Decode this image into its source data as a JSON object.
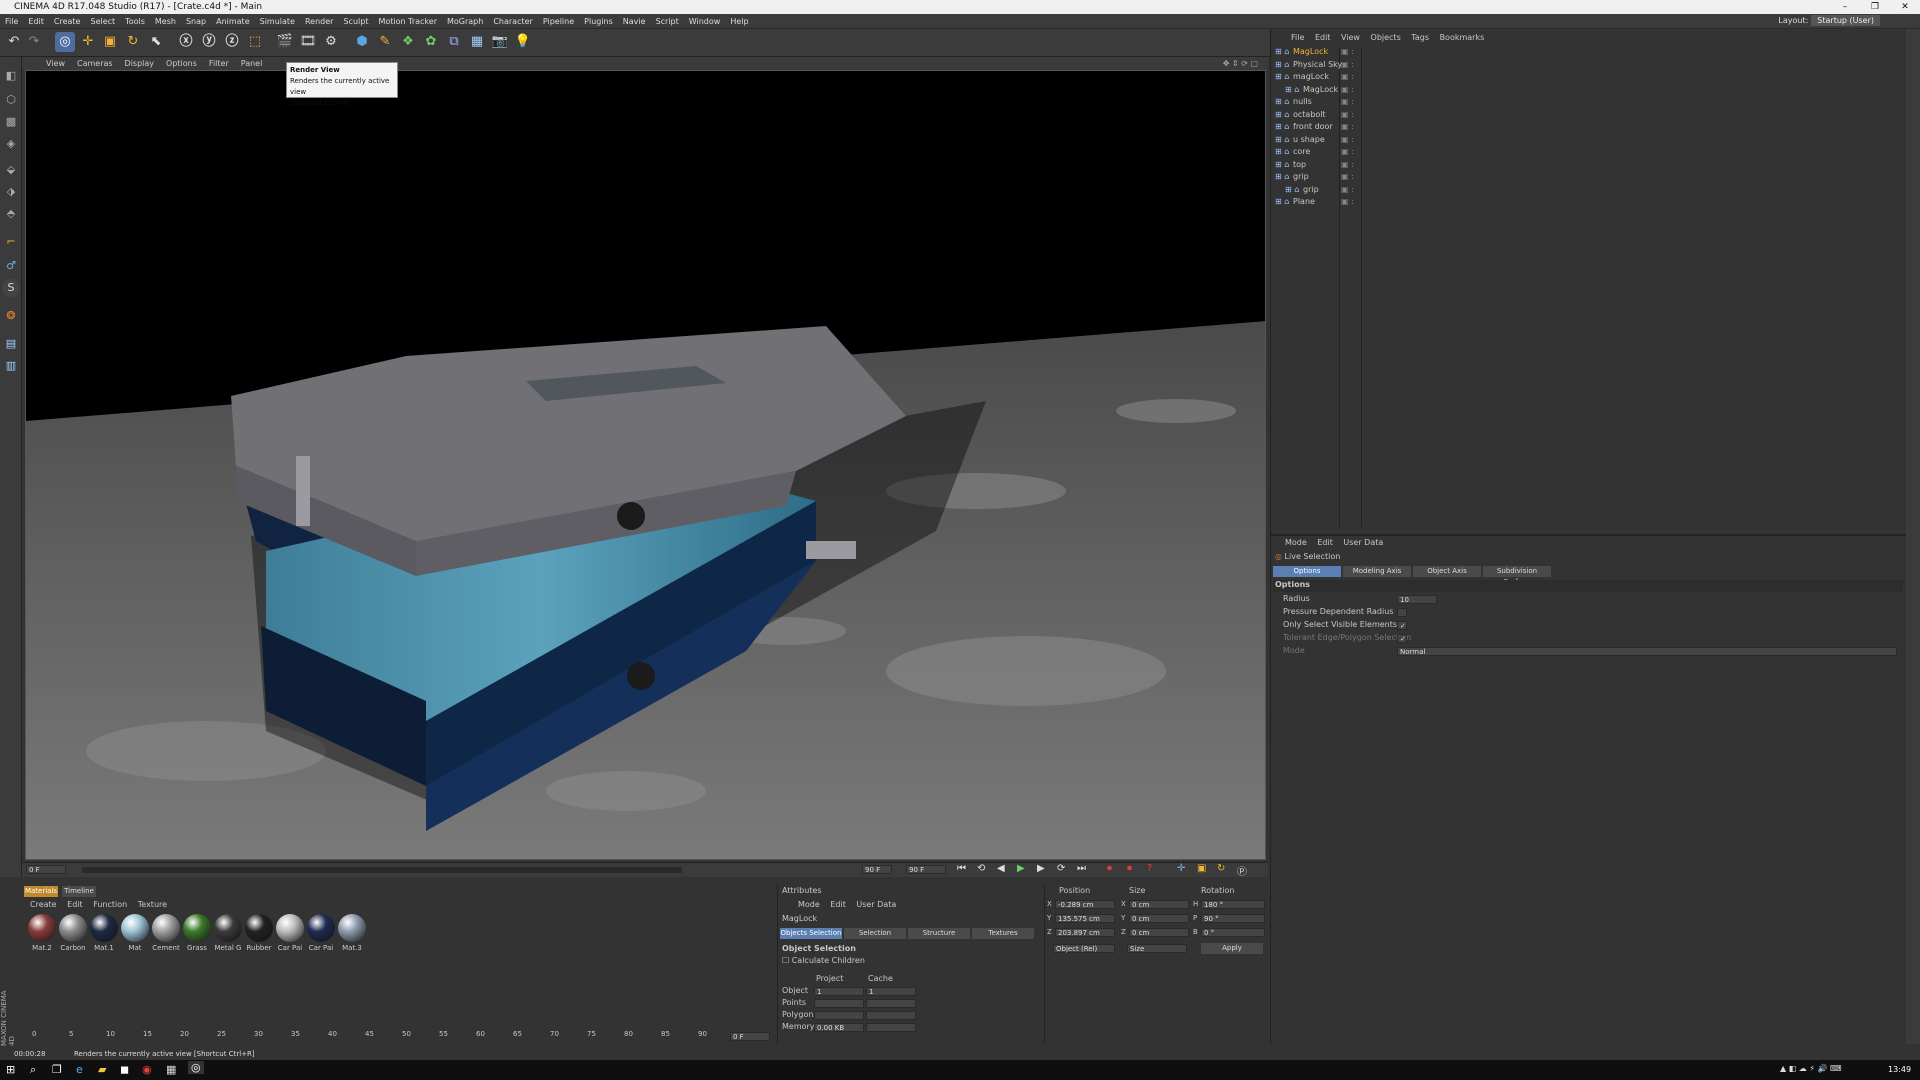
{
  "window": {
    "title": "CINEMA 4D R17.048 Studio (R17) - [Crate.c4d *] - Main"
  },
  "menu": {
    "items": [
      "File",
      "Edit",
      "Create",
      "Select",
      "Tools",
      "Mesh",
      "Snap",
      "Animate",
      "Simulate",
      "Render",
      "Sculpt",
      "Motion Tracker",
      "MoGraph",
      "Character",
      "Pipeline",
      "Plugins",
      "Navie",
      "Script",
      "Window",
      "Help"
    ],
    "layout_label": "Layout:",
    "layout_value": "Startup (User)"
  },
  "viewport": {
    "menu": [
      "View",
      "Cameras",
      "Display",
      "Options",
      "Filter",
      "Panel"
    ]
  },
  "tooltip": {
    "title": "Render View",
    "desc": "Renders the currently active view",
    "shortcut": "[Shortcut Ctrl+R]"
  },
  "timeline": {
    "start": "0 F",
    "end_field": "90 F",
    "end_field2": "90 F",
    "mark": "0"
  },
  "materials": {
    "tabs": [
      "Materials",
      "Timeline"
    ],
    "menu": [
      "Create",
      "Edit",
      "Function",
      "Texture"
    ],
    "items": [
      {
        "label": "Mat.2",
        "color": "#8a3b3b"
      },
      {
        "label": "Carbon",
        "color": "#8c8c8c"
      },
      {
        "label": "Mat.1",
        "color": "#1e2a44"
      },
      {
        "label": "Mat",
        "color": "#9fc3d6"
      },
      {
        "label": "Cement",
        "color": "#a0a0a0"
      },
      {
        "label": "Grass",
        "color": "#3b7a2a"
      },
      {
        "label": "Metal G",
        "color": "#3a3a3a"
      },
      {
        "label": "Rubber",
        "color": "#222222"
      },
      {
        "label": "Car Pai",
        "color": "#bdbdbd"
      },
      {
        "label": "Car Pai",
        "color": "#1f2c52"
      },
      {
        "label": "Mat.3",
        "color": "#8e9bb0"
      }
    ]
  },
  "ruler": {
    "ticks": [
      "0",
      "5",
      "10",
      "15",
      "20",
      "25",
      "30",
      "35",
      "40",
      "45",
      "50",
      "55",
      "60",
      "65",
      "70",
      "75",
      "80",
      "85",
      "90"
    ],
    "end": "0 F"
  },
  "attrbot": {
    "header": "Attributes",
    "menu": [
      "Mode",
      "Edit",
      "User Data"
    ],
    "object_name": "MagLock",
    "tabs": [
      "Objects Selection",
      "Selection",
      "Structure",
      "Textures"
    ],
    "section": "Object Selection",
    "calc_children": "Calculate Children",
    "col_project": "Project",
    "col_cache": "Cache",
    "rows": [
      {
        "label": "Object",
        "project": "1",
        "cache": "1"
      },
      {
        "label": "Points",
        "project": "",
        "cache": ""
      },
      {
        "label": "Polygons",
        "project": "",
        "cache": ""
      },
      {
        "label": "Memory",
        "project": "0.00 KB",
        "cache": ""
      }
    ]
  },
  "coords": {
    "headers": [
      "Position",
      "Size",
      "Rotation"
    ],
    "rows": [
      {
        "axis": "X",
        "pos": "-0.289 cm",
        "size_axis": "X",
        "size": "0 cm",
        "rot_axis": "H",
        "rot": "180 °"
      },
      {
        "axis": "Y",
        "pos": "135.575 cm",
        "size_axis": "Y",
        "size": "0 cm",
        "rot_axis": "P",
        "rot": "90 °"
      },
      {
        "axis": "Z",
        "pos": "203.897 cm",
        "size_axis": "Z",
        "size": "0 cm",
        "rot_axis": "B",
        "rot": "0 °"
      }
    ],
    "mode_select": "Object (Rel)",
    "size_select": "Size",
    "apply": "Apply"
  },
  "objmgr": {
    "menu": [
      "File",
      "Edit",
      "View",
      "Objects",
      "Tags",
      "Bookmarks"
    ],
    "objects": [
      {
        "name": "MagLock",
        "indent": 0,
        "highlight": true
      },
      {
        "name": "Physical Sky",
        "indent": 0
      },
      {
        "name": "magLock",
        "indent": 0
      },
      {
        "name": "MagLock",
        "indent": 1
      },
      {
        "name": "nulls",
        "indent": 0
      },
      {
        "name": "octabolt",
        "indent": 0
      },
      {
        "name": "front door",
        "indent": 0
      },
      {
        "name": "u shape",
        "indent": 0
      },
      {
        "name": "core",
        "indent": 0
      },
      {
        "name": "top",
        "indent": 0
      },
      {
        "name": "grip",
        "indent": 0
      },
      {
        "name": "grip",
        "indent": 1
      },
      {
        "name": "Plane",
        "indent": 0
      }
    ]
  },
  "attrtop": {
    "menu": [
      "Mode",
      "Edit",
      "User Data"
    ],
    "tool": "Live Selection",
    "tabs": [
      "Options",
      "Modeling Axis",
      "Object Axis",
      "Subdivision Surface"
    ],
    "section": "Options",
    "fields": [
      {
        "label": "Radius",
        "value": "10"
      },
      {
        "label": "Pressure Dependent Radius",
        "value": ""
      },
      {
        "label": "Only Select Visible Elements",
        "value": "✓"
      },
      {
        "label": "Tolerant Edge/Polygon Selection",
        "value": "✓"
      },
      {
        "label": "Mode",
        "value": "Normal"
      }
    ]
  },
  "status": {
    "time": "00:00:28",
    "text": "Renders the currently active view [Shortcut Ctrl+R]"
  },
  "brand": {
    "text": "MAXON CINEMA 4D"
  },
  "clock": {
    "time": "13:49"
  }
}
